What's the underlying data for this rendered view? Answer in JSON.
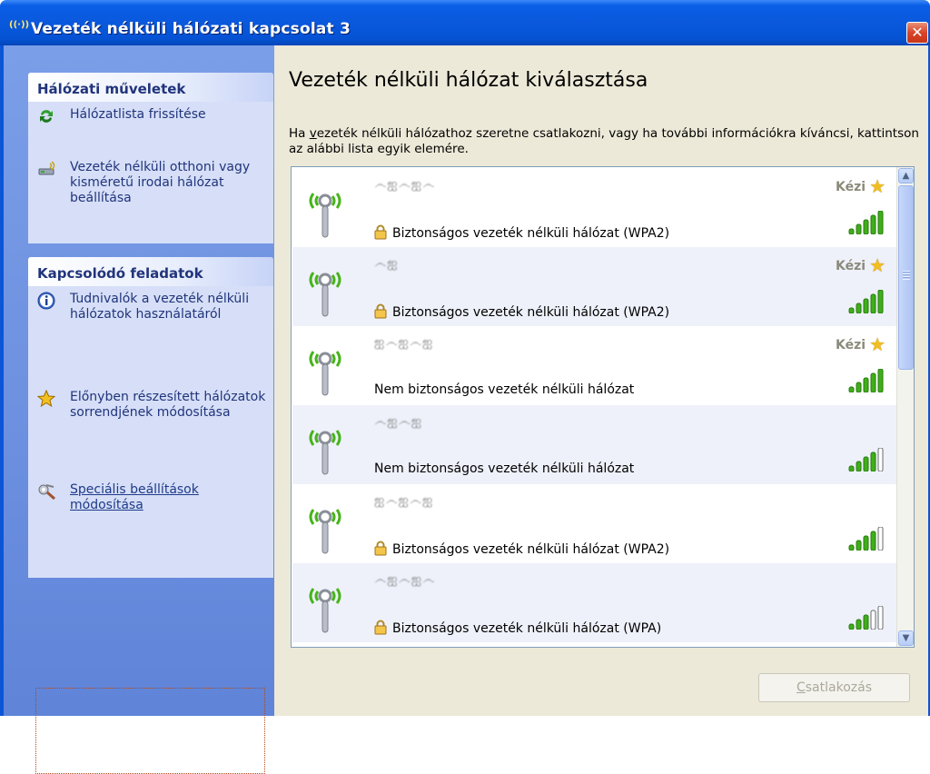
{
  "window": {
    "title": "Vezeték nélküli hálózati kapcsolat 3",
    "close_glyph": "✕",
    "title_icon": "((·))"
  },
  "sidebar": {
    "network_tasks": {
      "title": "Hálózati műveletek",
      "items": [
        {
          "label": "Hálózatlista frissítése",
          "icon": "refresh-icon"
        },
        {
          "label": "Vezeték nélküli otthoni vagy kisméretű irodai hálózat beállítása",
          "icon": "wireless-setup-icon"
        }
      ]
    },
    "related_tasks": {
      "title": "Kapcsolódó feladatok",
      "items": [
        {
          "label": "Tudnivalók a vezeték nélküli hálózatok használatáról",
          "icon": "info-icon"
        },
        {
          "label": "Előnyben részesített hálózatok sorrendjének módosítása",
          "icon": "star-icon"
        },
        {
          "label": "Speciális beállítások módosítása",
          "icon": "advanced-settings-icon"
        }
      ]
    }
  },
  "main": {
    "heading": "Vezeték nélküli hálózat kiválasztása",
    "description_before": "Ha ",
    "description_accel": "v",
    "description_after": "ezeték nélküli hálózathoz szeretne csatlakozni, vagy ha további információkra kíváncsi, kattintson az alábbi lista egyik elemére.",
    "networks": [
      {
        "ssid": "෴ஐ෴ஐ෴",
        "security": "Biztonságos vezeték nélküli hálózat (WPA2)",
        "secure": true,
        "manual": "Kézi",
        "signal": 5
      },
      {
        "ssid": "෴ஐ",
        "security": "Biztonságos vezeték nélküli hálózat (WPA2)",
        "secure": true,
        "manual": "Kézi",
        "signal": 5
      },
      {
        "ssid": "ஐ෴ஐ෴ஐ",
        "security": "Nem biztonságos vezeték nélküli hálózat",
        "secure": false,
        "manual": "Kézi",
        "signal": 5
      },
      {
        "ssid": "෴ஐ෴ஐ",
        "security": "Nem biztonságos vezeték nélküli hálózat",
        "secure": false,
        "manual": "",
        "signal": 4
      },
      {
        "ssid": "ஐ෴ஐ෴ஐ",
        "security": "Biztonságos vezeték nélküli hálózat (WPA2)",
        "secure": true,
        "manual": "",
        "signal": 4
      },
      {
        "ssid": "෴ஐ෴ஐ෴",
        "security": "Biztonságos vezeték nélküli hálózat (WPA)",
        "secure": true,
        "manual": "",
        "signal": 3
      }
    ],
    "connect_accel": "C",
    "connect_rest": "satlakozás"
  },
  "colors": {
    "titlebar": "#0a58dc",
    "sidebar": "#6c8fdf",
    "panel": "#d6dff7",
    "panel_text": "#21347c",
    "signal_green": "#3fae1a"
  }
}
